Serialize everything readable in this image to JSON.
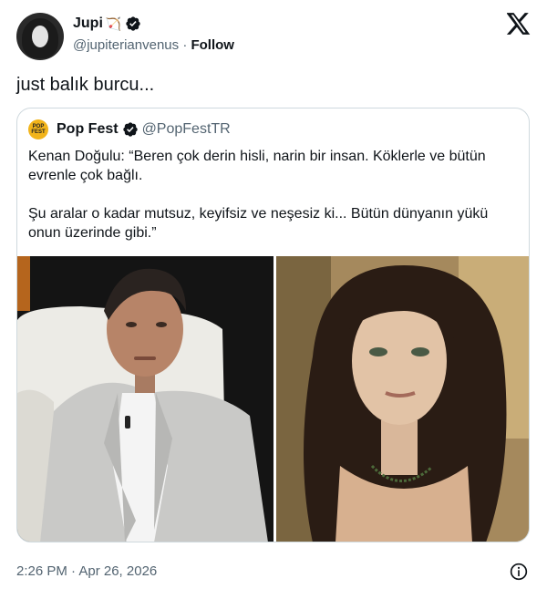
{
  "author": {
    "name": "Jupi",
    "handle": "@jupiterianvenus",
    "separator": "·",
    "follow_label": "Follow",
    "verified": true,
    "name_emoji_icon": "bow-and-arrow-icon"
  },
  "platform_icon": "x-logo-icon",
  "tweet": {
    "text": "just balık burcu..."
  },
  "quoted": {
    "avatar_text": "POP FEST",
    "name": "Pop Fest",
    "handle": "@PopFestTR",
    "verified": true,
    "paragraphs": [
      "Kenan Doğulu: “Beren çok derin hisli, narin bir insan. Köklerle ve bütün evrenle çok bağlı.",
      "Şu aralar o kadar mutsuz, keyifsiz ve neşesiz ki... Bütün dünyanın yükü onun üzerinde gibi.”"
    ],
    "media": [
      {
        "description_icon": "man-in-grey-suit-photo"
      },
      {
        "description_icon": "woman-with-long-dark-hair-photo"
      }
    ]
  },
  "footer": {
    "timestamp": "2:26 PM · Apr 26, 2026",
    "info_icon": "info-icon"
  },
  "colors": {
    "text": "#0f1419",
    "secondary": "#536471",
    "verified": "#1d9bf0",
    "border": "#cfd9de"
  }
}
